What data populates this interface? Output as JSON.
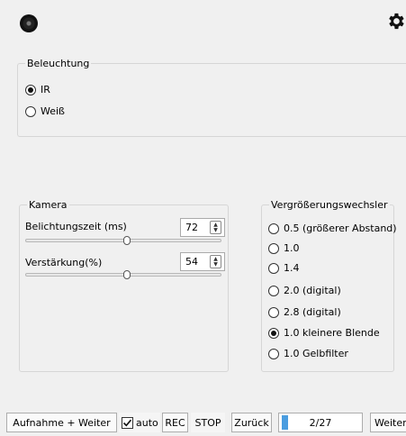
{
  "header": {
    "logo_icon": "camera-lens-icon",
    "settings_icon": "gear-icon"
  },
  "beleuchtung": {
    "legend": "Beleuchtung",
    "options": [
      {
        "label": "IR",
        "checked": true
      },
      {
        "label": "Weiß",
        "checked": false
      }
    ]
  },
  "kamera": {
    "legend": "Kamera",
    "exposure": {
      "label": "Belichtungszeit (ms)",
      "value": "72",
      "slider_fraction": 0.52
    },
    "gain": {
      "label": "Verstärkung(%)",
      "value": "54",
      "slider_fraction": 0.52
    }
  },
  "vergroesserung": {
    "legend": "Vergrößerungswechsler",
    "options": [
      {
        "label": "0.5 (größerer Abstand)",
        "checked": false
      },
      {
        "label": "1.0",
        "checked": false
      },
      {
        "label": "1.4",
        "checked": false
      },
      {
        "label": "2.0 (digital)",
        "checked": false
      },
      {
        "label": "2.8 (digital)",
        "checked": false
      },
      {
        "label": "1.0 kleinere Blende",
        "checked": true
      },
      {
        "label": "1.0 Gelbfilter",
        "checked": false
      }
    ]
  },
  "toolbar": {
    "capture_next": "Aufnahme + Weiter",
    "auto_label": "auto",
    "auto_checked": true,
    "rec": "REC",
    "stop": "STOP",
    "back": "Zurück",
    "counter": "2/27",
    "counter_progress": 0.074,
    "next": "Weiter"
  }
}
